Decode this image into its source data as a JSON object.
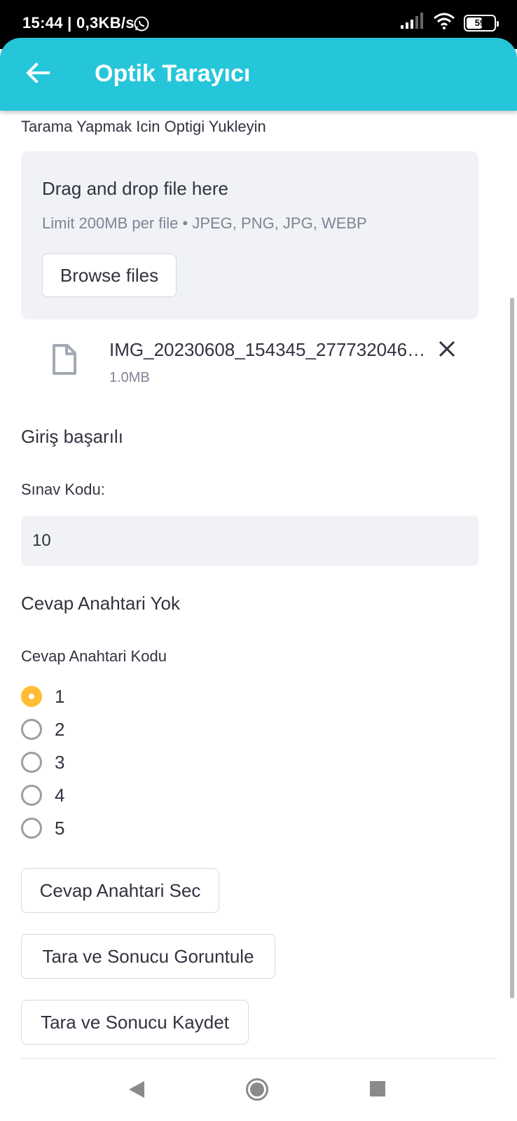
{
  "status_bar": {
    "time_speed": "15:44 | 0,3KB/s",
    "battery": "59",
    "battery_level": 0.59
  },
  "app_bar": {
    "title": "Optik Tarayıcı"
  },
  "upload": {
    "label": "Tarama Yapmak Icin Optigi Yukleyin",
    "dropzone_title": "Drag and drop file here",
    "dropzone_limit": "Limit 200MB per file • JPEG, PNG, JPG, WEBP",
    "browse_label": "Browse files"
  },
  "file": {
    "name": "IMG_20230608_154345_277732046…",
    "size": "1.0MB"
  },
  "status_messages": {
    "login_success": "Giriş başarılı",
    "no_answer_key": "Cevap Anahtari Yok"
  },
  "exam_code": {
    "label": "Sınav Kodu:",
    "value": "10"
  },
  "answer_key": {
    "label": "Cevap Anahtari Kodu",
    "options": [
      "1",
      "2",
      "3",
      "4",
      "5"
    ],
    "selected": "1"
  },
  "buttons": {
    "select_key": "Cevap Anahtari Sec",
    "scan_view": "Tara ve Sonucu Goruntule",
    "scan_save": "Tara ve Sonucu Kaydet"
  },
  "colors": {
    "app_bar": "#26c6da",
    "radio_selected": "#ffbd33",
    "dropzone_bg": "#f0f2f6",
    "text": "#31333f",
    "muted_text": "#808495"
  }
}
